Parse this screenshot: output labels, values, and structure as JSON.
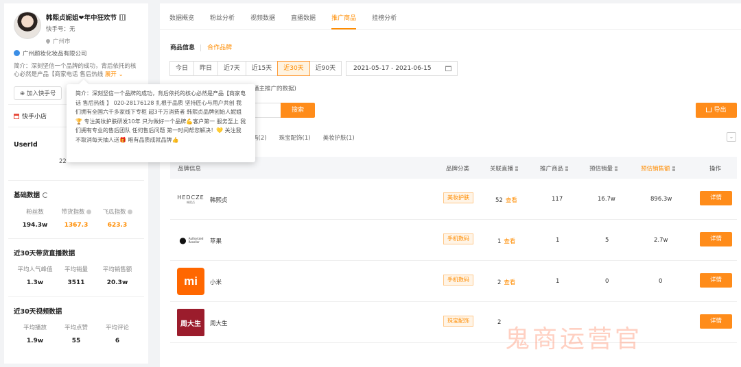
{
  "profile": {
    "name": "韩熙贞妮姐❤年中狂欢节",
    "ks_id": "快手号：无",
    "location": "广州市",
    "company": "广州颜妆化妆品有限公司",
    "intro": "简介：深刻坚信一个品牌的成功，背后依托的核心必然是产品【商家电话 售后热线",
    "expand": "展开",
    "add_ks": "加入快手号",
    "store": "快手小店",
    "userid_label": "UserId",
    "userid_value": "22"
  },
  "tooltip": {
    "text": "简介：深刻坚信一个品牌的成功，背后依托的核心必然是产品【商家电话 售后热线 】 020-28176128 扎根于品质 坚持匠心与用户共创 我们拥有全国六千多家线下专柜 超3千万消费者 韩熙贞品牌创始人妮姐🏆 专注美妆护肤研发10年 只为做好一个品牌💪客户第一 服务至上 我们拥有专业的售后团队 任何售后问题 第一时间帮您解决！💛 关注我不取消每天抽人送🎁 唯有品质成就品牌👍"
  },
  "basic": {
    "title": "基础数据",
    "items": [
      {
        "label": "粉丝数",
        "value": "194.3w",
        "highlight": false
      },
      {
        "label": "带货指数",
        "value": "1367.3",
        "highlight": true
      },
      {
        "label": "飞瓜指数",
        "value": "623.3",
        "highlight": true
      }
    ]
  },
  "live30": {
    "title": "近30天带货直播数据",
    "items": [
      {
        "label": "平均人气峰值",
        "value": "1.3w"
      },
      {
        "label": "平均销量",
        "value": "3511"
      },
      {
        "label": "平均销售额",
        "value": "20.3w"
      }
    ]
  },
  "video30": {
    "title": "近30天视频数据",
    "items": [
      {
        "label": "平均播放",
        "value": "1.9w"
      },
      {
        "label": "平均点赞",
        "value": "55"
      },
      {
        "label": "平均评论",
        "value": "6"
      }
    ]
  },
  "tabs": [
    "数据概览",
    "粉丝分析",
    "视频数据",
    "直播数据",
    "推广商品",
    "挂榜分析"
  ],
  "subtabs": {
    "info": "商品信息",
    "brand": "合作品牌"
  },
  "ranges": [
    "今日",
    "昨日",
    "近7天",
    "近15天",
    "近30天",
    "近90天"
  ],
  "date_range": "2021-05-17  -  2021-06-15",
  "note": "播主推广的数据)",
  "search_btn": "搜索",
  "export_btn": "导出",
  "categories": [
    "码(2)",
    "珠宝配饰(1)",
    "美妆护肤(1)"
  ],
  "columns": {
    "brand_info": "品牌信息",
    "brand_cat": "品牌分类",
    "live": "关联直播",
    "products": "推广商品",
    "sales": "预估销量",
    "revenue": "预估销售额",
    "ops": "操作"
  },
  "rows": [
    {
      "logo_text": "HEDCZE",
      "logo_sub": "韩熙贞",
      "name": "韩熙贞",
      "category": "美妆护肤",
      "live": "52",
      "products": "117",
      "sales": "16.7w",
      "revenue": "896.3w"
    },
    {
      "logo_text": "Authorized Reseller",
      "logo_sub": "",
      "name": "苹果",
      "category": "手机数码",
      "live": "1",
      "products": "1",
      "sales": "5",
      "revenue": "2.7w"
    },
    {
      "logo_text": "mi",
      "logo_sub": "",
      "name": "小米",
      "category": "手机数码",
      "live": "2",
      "products": "1",
      "sales": "0",
      "revenue": "0"
    },
    {
      "logo_text": "周大生",
      "logo_sub": "",
      "name": "周大生",
      "category": "珠宝配饰",
      "live": "2",
      "products": "",
      "sales": "",
      "revenue": ""
    }
  ],
  "view_label": "查看",
  "detail_label": "详情",
  "watermark": "鬼商运营官",
  "colors": {
    "accent": "#ff8c1a",
    "xiaomi": "#ff6700",
    "zhoudasheng": "#9b1c2c"
  }
}
